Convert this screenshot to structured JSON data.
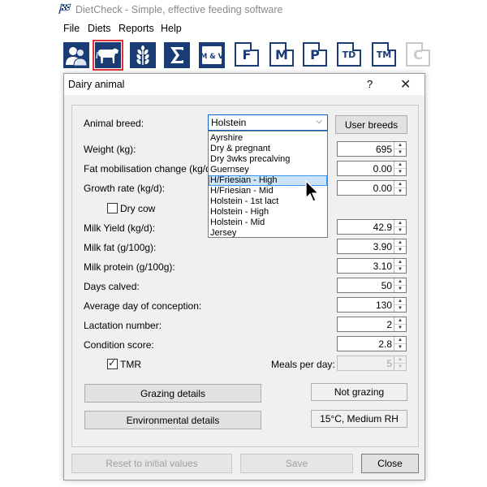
{
  "app": {
    "title": "DietCheck - Simple, effective feeding software"
  },
  "menu": {
    "items": [
      "File",
      "Diets",
      "Reports",
      "Help"
    ]
  },
  "toolbar": {
    "buttons": [
      {
        "icon": "users-icon"
      },
      {
        "icon": "cow-icon",
        "selected": true
      },
      {
        "icon": "wheat-icon"
      },
      {
        "icon": "sigma-icon"
      },
      {
        "icon": "minerals-vitamins-icon",
        "label": "M & V"
      },
      {
        "label": "F"
      },
      {
        "label": "M"
      },
      {
        "label": "P"
      },
      {
        "label": "TD"
      },
      {
        "label": "TM"
      },
      {
        "label": "C",
        "disabled": true
      }
    ]
  },
  "dialog": {
    "title": "Dairy animal",
    "help": "?",
    "close": "✕",
    "breed": {
      "label": "Animal breed:",
      "value": "Holstein",
      "options": [
        "Ayrshire",
        "Dry & pregnant",
        "Dry 3wks precalving",
        "Guernsey",
        "H/Friesian - High",
        "H/Friesian - Mid",
        "Holstein - 1st lact",
        "Holstein - High",
        "Holstein - Mid",
        "Jersey"
      ],
      "highlighted": "H/Friesian - High"
    },
    "user_breeds": "User breeds",
    "fields": {
      "weight": {
        "label": "Weight (kg):",
        "value": "695"
      },
      "fat_mob": {
        "label": "Fat mobilisation change (kg/d):",
        "value": "0.00"
      },
      "growth": {
        "label": "Growth rate (kg/d):",
        "value": "0.00"
      },
      "dry_cow": {
        "label": "Dry cow",
        "checked": false
      },
      "milk_yield": {
        "label": "Milk Yield (kg/d):",
        "value": "42.9"
      },
      "milk_fat": {
        "label": "Milk fat (g/100g):",
        "value": "3.90"
      },
      "milk_protein": {
        "label": "Milk protein (g/100g):",
        "value": "3.10"
      },
      "days_calved": {
        "label": "Days calved:",
        "value": "50"
      },
      "avg_conception": {
        "label": "Average day of conception:",
        "value": "130"
      },
      "lactation": {
        "label": "Lactation number:",
        "value": "2"
      },
      "condition": {
        "label": "Condition score:",
        "value": "2.8"
      },
      "tmr": {
        "label": "TMR",
        "checked": true
      },
      "meals": {
        "label": "Meals per day:",
        "value": "5"
      }
    },
    "grazing_btn": "Grazing details",
    "grazing_status": "Not grazing",
    "env_btn": "Environmental details",
    "env_status": "15°C, Medium RH",
    "reset_btn": "Reset to initial values",
    "save_btn": "Save",
    "close_btn": "Close"
  },
  "colors": {
    "toolbar_icon": "#1a3c74",
    "selected_outline": "#e0343a",
    "dropdown_highlight": "#cce4f7"
  }
}
